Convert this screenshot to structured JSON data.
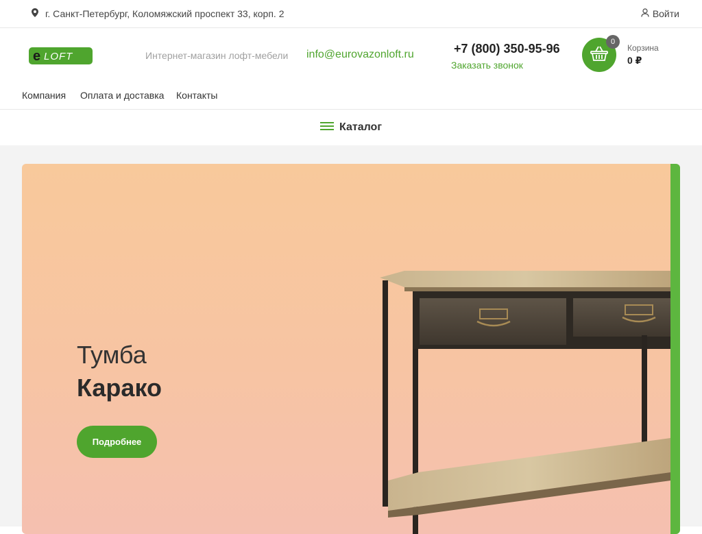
{
  "topbar": {
    "address": "г. Санкт-Петербург, Коломяжский проспект 33, корп. 2",
    "login": "Войти"
  },
  "header": {
    "logo_text": "eLOFT",
    "tagline": "Интернет-магазин лофт-мебели",
    "email": "info@eurovazonloft.ru",
    "phone": "+7 (800) 350-95-96",
    "callback": "Заказать звонок",
    "cart": {
      "count": "0",
      "label": "Корзина",
      "sum": "0 ₽"
    }
  },
  "nav": {
    "items": [
      {
        "label": "Компания"
      },
      {
        "label": "Оплата и доставка"
      },
      {
        "label": "Контакты"
      }
    ]
  },
  "catalog": {
    "label": "Каталог"
  },
  "banner": {
    "title_line1": "Тумба",
    "title_line2": "Карако",
    "button": "Подробнее"
  },
  "colors": {
    "accent": "#4fa52e",
    "banner_gradient_top": "#f8c99b",
    "banner_gradient_bottom": "#f5c0b0",
    "page_bg": "#f3f3f3"
  },
  "icons": [
    "location-pin-icon",
    "user-icon",
    "basket-icon",
    "hamburger-icon"
  ]
}
